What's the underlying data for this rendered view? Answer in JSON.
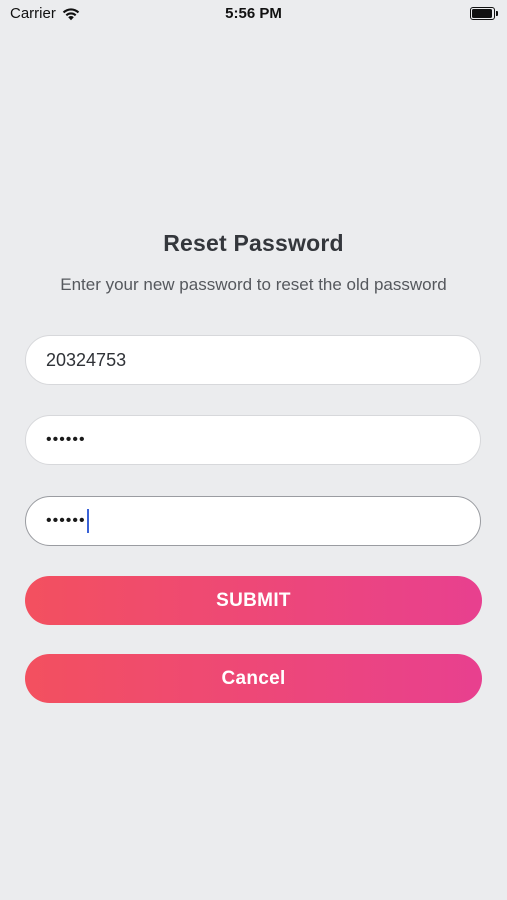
{
  "status_bar": {
    "carrier": "Carrier",
    "time": "5:56 PM"
  },
  "screen": {
    "title": "Reset Password",
    "subtitle": "Enter your new password to reset the old password"
  },
  "form": {
    "username_value": "20324753",
    "new_password_value": "••••••",
    "confirm_password_value": "••••••"
  },
  "buttons": {
    "submit_label": "SUBMIT",
    "cancel_label": "Cancel"
  },
  "colors": {
    "background": "#ebecee",
    "button_gradient_start": "#f3505f",
    "button_gradient_end": "#e8408f",
    "caret": "#3a62d6"
  },
  "icons": {
    "wifi": "wifi-icon",
    "battery": "battery-icon"
  }
}
